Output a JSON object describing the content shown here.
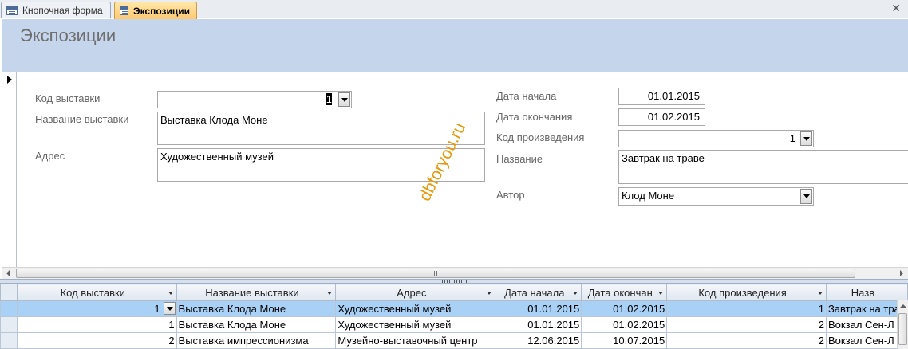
{
  "tabs": [
    {
      "label": "Кнопочная форма",
      "active": false
    },
    {
      "label": "Экспозиции",
      "active": true
    }
  ],
  "form": {
    "title": "Экспозиции",
    "fields": {
      "exhibition_code": {
        "label": "Код выставки",
        "value": "1"
      },
      "exhibition_name": {
        "label": "Название выставки",
        "value": "Выставка Клода Моне"
      },
      "address": {
        "label": "Адрес",
        "value": "Художественный музей"
      },
      "start_date": {
        "label": "Дата начала",
        "value": "01.01.2015"
      },
      "end_date": {
        "label": "Дата окончания",
        "value": "01.02.2015"
      },
      "artwork_code": {
        "label": "Код произведения",
        "value": "1"
      },
      "name": {
        "label": "Название",
        "value": "Завтрак на траве"
      },
      "author": {
        "label": "Автор",
        "value": "Клод Моне"
      }
    }
  },
  "watermark": "dbforyou.ru",
  "datasheet": {
    "columns": [
      "Код выставки",
      "Название выставки",
      "Адрес",
      "Дата начала",
      "Дата окончан",
      "Код произведения",
      "Назв"
    ],
    "rows": [
      [
        "1",
        "Выставка Клода Моне",
        "Художественный музей",
        "01.01.2015",
        "01.02.2015",
        "1",
        "Завтрак на трав"
      ],
      [
        "1",
        "Выставка Клода Моне",
        "Художественный музей",
        "01.01.2015",
        "01.02.2015",
        "2",
        "Вокзал Сен-Л"
      ],
      [
        "2",
        "Выставка импрессионизма",
        "Музейно-выставочный центр",
        "12.06.2015",
        "10.07.2015",
        "2",
        "Вокзал Сен-Л"
      ]
    ]
  },
  "colors": {
    "header_bg": "#c5d6ec",
    "active_tab": "#ffc870",
    "selected_row": "#a9d0f5",
    "watermark": "#e69a0e"
  }
}
